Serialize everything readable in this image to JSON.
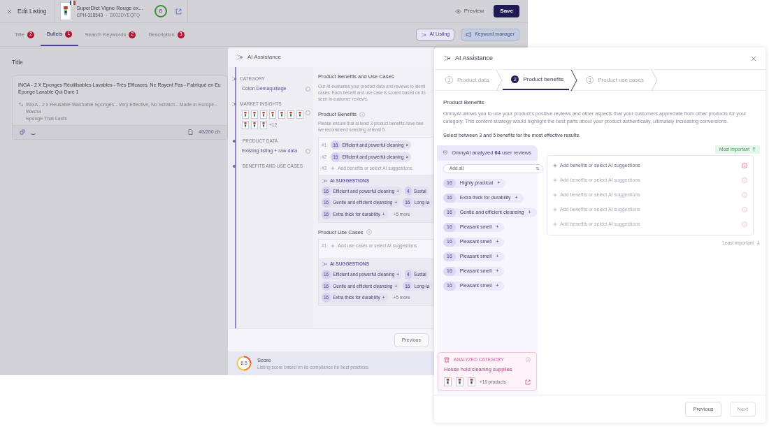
{
  "header": {
    "title": "Edit Listing",
    "product_name": "SuperDiet Vigne Rouge ex...",
    "sku": "CPH-318543",
    "separator": "-",
    "asin": "B002DYEQFQ",
    "score": "8",
    "preview": "Preview",
    "save": "Save"
  },
  "tabs": [
    {
      "label": "Title",
      "count": "2",
      "selected": false
    },
    {
      "label": "Bullets",
      "count": "1",
      "selected": true
    },
    {
      "label": "Search Keywords",
      "count": "2",
      "selected": false
    },
    {
      "label": "Description",
      "count": "3",
      "selected": false
    }
  ],
  "toolbar": {
    "ai_listing": "AI Listing",
    "keyword_manager": "Keyword manager"
  },
  "title_field": {
    "label": "Title",
    "lines": [
      "INGA - 2 X Eponges Réutilisables Lavables - Très Efficaces, Ne Rayent Pas - Fabriqué en Eu",
      "Éponge Lavable Qui Dure 1"
    ],
    "translation": [
      "INGA - 2 x Reusable Washable Sponges - Very Effective, No Scratch - Made in Europe - Washa",
      "Sponge That Lasts"
    ],
    "char_count": "40/200 ch"
  },
  "back_panel": {
    "title": "AI Assistance",
    "steps": [
      {
        "kind": "ai",
        "label": "CATEGORY",
        "value": "Coton Démaquillage"
      },
      {
        "kind": "thumbs",
        "label": "MARKET INSIGHTS",
        "more": "+12"
      },
      {
        "kind": "dot",
        "label": "PRODUCT DATA",
        "value": "Existing listing + raw data"
      },
      {
        "kind": "dot",
        "label": "BENEFITS AND USE CASES"
      }
    ],
    "heading": "Product Benefits and Use Cases",
    "description": [
      "Our AI evaluates your product data and reviews to identi",
      "cases: Each benefit and use case is scored based on its",
      "seen in customer reviews."
    ],
    "benefits": {
      "title": "Product Benefits",
      "hint": [
        "Please ensure that at least 3 product benefits have bee",
        "we recommend selecting at least 5."
      ],
      "selected": [
        {
          "index": "#1",
          "count": "16",
          "label": "Efficient and powerful cleaning",
          "remove": "×"
        },
        {
          "index": "#2",
          "count": "16",
          "label": "Efficient and powerful cleaning",
          "remove": "×"
        }
      ],
      "next_index": "#3",
      "placeholder": "Add benefits or select AI suggestions",
      "suggestions_title": "AI SUGGESTIONS",
      "suggestions": [
        [
          {
            "kind": "chip",
            "count": "16",
            "label": "Efficient and powerful cleaning",
            "action": "+"
          },
          {
            "kind": "chip",
            "count": "4",
            "label": "Sustai"
          }
        ],
        [
          {
            "kind": "chip",
            "count": "16",
            "label": "Gentle and efficient cleansing",
            "action": "+"
          },
          {
            "kind": "chip",
            "count": "16",
            "label": "Long-la"
          }
        ],
        [
          {
            "kind": "chip",
            "count": "16",
            "label": "Extra thick for durability",
            "action": "+"
          },
          {
            "kind": "more",
            "label": "+5 more"
          }
        ]
      ]
    },
    "use_cases": {
      "title": "Product Use Cases",
      "next_index": "#1",
      "placeholder": "Add use cases or select AI suggestions",
      "suggestions_title": "AI SUGGESTIONS",
      "suggestions": [
        [
          {
            "kind": "chip",
            "count": "16",
            "label": "Efficient and powerful cleaning",
            "action": "+"
          },
          {
            "kind": "chip",
            "count": "4",
            "label": "Sustai"
          }
        ],
        [
          {
            "kind": "chip",
            "count": "16",
            "label": "Gentle and efficient cleansing",
            "action": "+"
          },
          {
            "kind": "chip",
            "count": "16",
            "label": "Long-la"
          }
        ],
        [
          {
            "kind": "chip",
            "count": "16",
            "label": "Extra thick for durability",
            "action": "+"
          },
          {
            "kind": "more",
            "label": "+5 more"
          }
        ]
      ]
    },
    "previous": "Previous",
    "score": {
      "value": "6.5",
      "title": "Score",
      "caption": "Listing score based on its compliance for best practices"
    }
  },
  "assistant": {
    "title": "AI Assistance",
    "steps": [
      {
        "number": "1",
        "label": "Product data",
        "selected": false
      },
      {
        "number": "2",
        "label": "Product benefits",
        "selected": true
      },
      {
        "number": "3",
        "label": "Product use cases",
        "selected": false
      }
    ],
    "heading": "Product Benefits",
    "description": "OmnyAI allows you to use your product’s positive reviews and other aspects that your customers appreciate from other products for your category. This content strategy would highlight the best parts about your product authentically, ultimately increasing conversions.",
    "instruction": "Select between 3 and 5 benefits for the most effective results.",
    "analysis": "OmnyAI analyzed **64** user reviews",
    "add_all": "Add all",
    "suggestions": [
      {
        "count": "16",
        "label": "Highly practical",
        "action": "+"
      },
      {
        "count": "16",
        "label": "Extra thick for durability",
        "action": "+"
      },
      {
        "count": "16",
        "label": "Gentle and efficient cleansing",
        "action": "+"
      },
      {
        "count": "16",
        "label": "Pleasant smell",
        "action": "+"
      },
      {
        "count": "16",
        "label": "Pleasant smell",
        "action": "+"
      },
      {
        "count": "16",
        "label": "Pleasant smell",
        "action": "+"
      },
      {
        "count": "16",
        "label": "Pleasant smell",
        "action": "+"
      },
      {
        "count": "16",
        "label": "Pleasant smell",
        "action": "+"
      }
    ],
    "category": {
      "label": "ANALYZED CATEGORY",
      "name": "House hold cleaning supplies",
      "more": "+10 products"
    },
    "most_important": "Most important",
    "slots": [
      {
        "placeholder": "Add benefits or select AI suggestions",
        "highlighted": true
      },
      {
        "placeholder": "Add benefits or select AI suggestions",
        "highlighted": false
      },
      {
        "placeholder": "Add benefits or select AI suggestions",
        "highlighted": false
      },
      {
        "placeholder": "Add benefits or select AI suggestions",
        "highlighted": false
      },
      {
        "placeholder": "Add benefits or select AI suggestions",
        "highlighted": false
      }
    ],
    "least_important": "Least important",
    "previous": "Previous",
    "next": {
      "label": "Next",
      "disabled": true
    }
  }
}
